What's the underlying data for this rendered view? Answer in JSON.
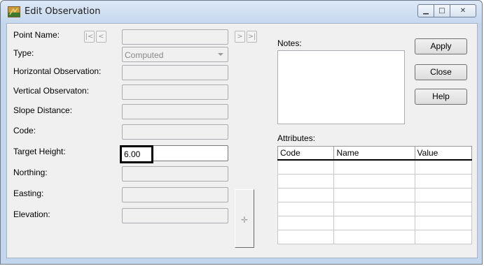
{
  "window": {
    "title": "Edit Observation",
    "icon": "survey-app-icon",
    "controls": {
      "minimize": "minimize-icon",
      "maximize": "maximize-icon",
      "close": "close-icon"
    }
  },
  "form": {
    "point_name": {
      "label": "Point Name:",
      "value": ""
    },
    "nav": {
      "first": "|<",
      "prev": "<",
      "next": ">",
      "last": ">|"
    },
    "type": {
      "label": "Type:",
      "value": "Computed"
    },
    "horizontal_observation": {
      "label": "Horizontal Observation:",
      "value": ""
    },
    "vertical_observation": {
      "label": "Vertical Observaton:",
      "value": ""
    },
    "slope_distance": {
      "label": "Slope Distance:",
      "value": ""
    },
    "code": {
      "label": "Code:",
      "value": ""
    },
    "target_height": {
      "label": "Target Height:",
      "value": "6.00"
    },
    "northing": {
      "label": "Northing:",
      "value": ""
    },
    "easting": {
      "label": "Easting:",
      "value": ""
    },
    "elevation": {
      "label": "Elevation:",
      "value": ""
    },
    "pick_icon": "crosshair-icon"
  },
  "notes": {
    "label": "Notes:",
    "value": ""
  },
  "buttons": {
    "apply": "Apply",
    "close": "Close",
    "help": "Help"
  },
  "attributes": {
    "label": "Attributes:",
    "columns": [
      "Code",
      "Name",
      "Value"
    ],
    "rows": [
      [
        "",
        "",
        ""
      ],
      [
        "",
        "",
        ""
      ],
      [
        "",
        "",
        ""
      ],
      [
        "",
        "",
        ""
      ],
      [
        "",
        "",
        ""
      ],
      [
        "",
        "",
        ""
      ]
    ]
  }
}
